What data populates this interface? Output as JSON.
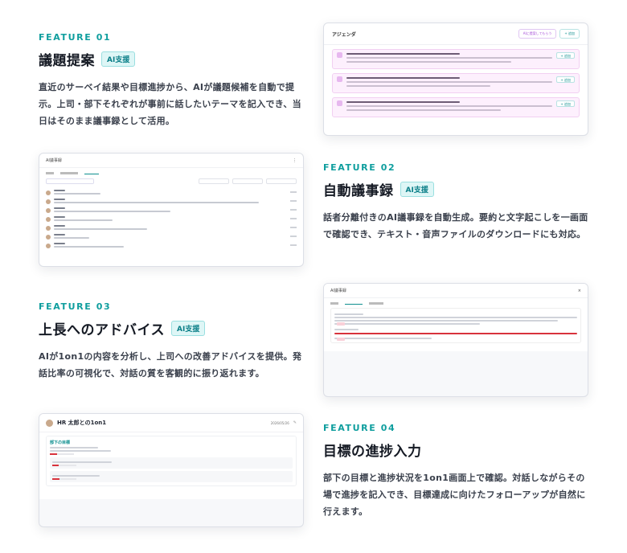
{
  "features": [
    {
      "label": "FEATURE 01",
      "title": "議題提案",
      "badge": "AI支援",
      "desc": "直近のサーベイ結果や目標進捗から、AIが議題候補を自動で提示。上司・部下それぞれが事前に話したいテーマを記入でき、当日はそのまま議事録として活用。"
    },
    {
      "label": "FEATURE 02",
      "title": "自動議事録",
      "badge": "AI支援",
      "desc": "話者分離付きのAI議事録を自動生成。要約と文字起こしを一画面で確認でき、テキスト・音声ファイルのダウンロードにも対応。"
    },
    {
      "label": "FEATURE 03",
      "title": "上長へのアドバイス",
      "badge": "AI支援",
      "desc": "AIが1on1の内容を分析し、上司への改善アドバイスを提供。発話比率の可視化で、対話の質を客観的に振り返れます。"
    },
    {
      "label": "FEATURE 04",
      "title": "目標の進捗入力",
      "badge": "",
      "desc": "部下の目標と進捗状況を1on1画面上で確認。対話しながらその場で進捗を記入でき、目標達成に向けたフォローアップが自然に行えます。"
    }
  ],
  "agenda_shot": {
    "title": "アジェンダ",
    "suggest_button": "AIに提案してもらう",
    "add_button": "+ 追加",
    "item_add": "+ 追加"
  },
  "transcript_shot": {
    "title": "AI議事録"
  },
  "summary_shot": {
    "title": "AI議事録"
  },
  "goal_shot": {
    "title": "HR 太郎との1on1",
    "date": "2026/05/26",
    "section": "部下の目標",
    "progress": [
      0.3,
      0.25
    ]
  },
  "colors": {
    "accent": "#0f9e9e",
    "badge_bg": "#def6f6",
    "agenda_pink": "#fdf0fd",
    "progress_red": "#d8323c"
  }
}
